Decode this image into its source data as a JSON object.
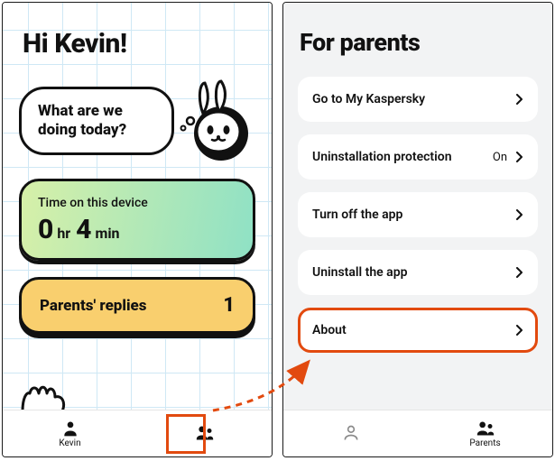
{
  "left": {
    "greeting": "Hi Kevin!",
    "speech": "What are we doing today?",
    "time_label": "Time on this device",
    "time_hours": "0",
    "time_hours_unit": "hr",
    "time_mins": "4",
    "time_mins_unit": "min",
    "replies_label": "Parents' replies",
    "replies_count": "1",
    "nav": {
      "kid_label": "Kevin",
      "parents_label": ""
    }
  },
  "right": {
    "title": "For parents",
    "items": [
      {
        "label": "Go to My Kaspersky",
        "status": ""
      },
      {
        "label": "Uninstallation protection",
        "status": "On"
      },
      {
        "label": "Turn off the app",
        "status": ""
      },
      {
        "label": "Uninstall the app",
        "status": ""
      },
      {
        "label": "About",
        "status": ""
      }
    ],
    "nav": {
      "kid_label": "",
      "parents_label": "Parents"
    }
  },
  "highlight": {
    "color": "#e24a0f"
  }
}
